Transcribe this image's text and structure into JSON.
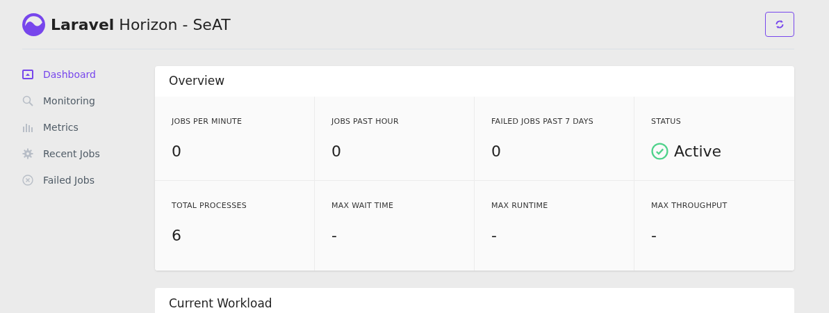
{
  "header": {
    "title": "**Laravel** Horizon - SeAT"
  },
  "sidebar": {
    "items": [
      {
        "label": "Dashboard",
        "selected": true
      },
      {
        "label": "Monitoring",
        "selected": false
      },
      {
        "label": "Metrics",
        "selected": false
      },
      {
        "label": "Recent Jobs",
        "selected": false
      },
      {
        "label": "Failed Jobs",
        "selected": false
      }
    ]
  },
  "overview": {
    "title": "Overview",
    "stats": [
      {
        "label": "JOBS PER MINUTE",
        "value": "0",
        "kind": "plain"
      },
      {
        "label": "JOBS PAST HOUR",
        "value": "0",
        "kind": "plain"
      },
      {
        "label": "FAILED JOBS PAST 7 DAYS",
        "value": "0",
        "kind": "plain"
      },
      {
        "label": "STATUS",
        "value": "Active",
        "kind": "status"
      },
      {
        "label": "TOTAL PROCESSES",
        "value": "6",
        "kind": "plain"
      },
      {
        "label": "MAX WAIT TIME",
        "value": "-",
        "kind": "plain"
      },
      {
        "label": "MAX RUNTIME",
        "value": "-",
        "kind": "plain"
      },
      {
        "label": "MAX THROUGHPUT",
        "value": "-",
        "kind": "plain"
      }
    ]
  },
  "workload": {
    "title": "Current Workload"
  }
}
